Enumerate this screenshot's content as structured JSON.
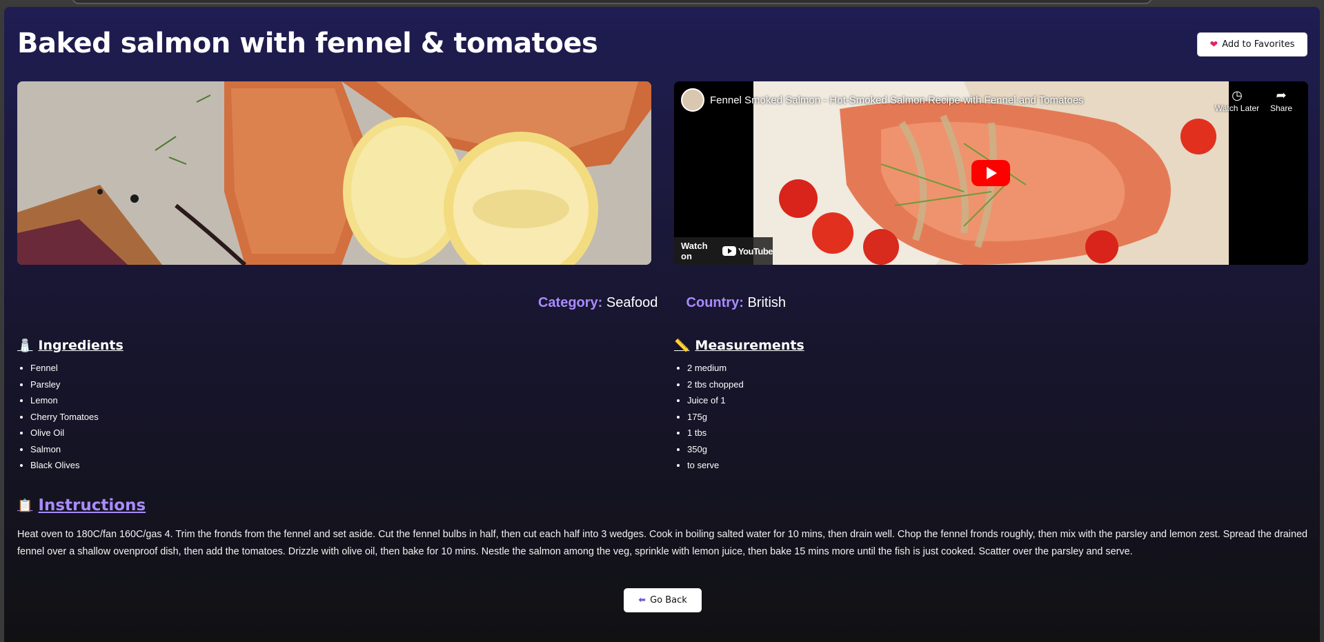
{
  "recipe": {
    "title": "Baked salmon with fennel & tomatoes",
    "favorite_label": "Add to Favorites",
    "category_label": "Category:",
    "category": "Seafood",
    "country_label": "Country:",
    "country": "British"
  },
  "video": {
    "title": "Fennel Smoked Salmon - Hot-Smoked Salmon Recipe with Fennel and Tomatoes",
    "watch_later": "Watch Later",
    "share": "Share",
    "watch_on": "Watch on",
    "youtube": "YouTube"
  },
  "ingredients": {
    "heading": "Ingredients",
    "icon": "salt-shaker-icon",
    "items": [
      "Fennel",
      "Parsley",
      "Lemon",
      "Cherry Tomatoes",
      "Olive Oil",
      "Salmon",
      "Black Olives"
    ]
  },
  "measurements": {
    "heading": "Measurements",
    "icon": "ruler-icon",
    "items": [
      "2 medium",
      "2 tbs chopped",
      "Juice of 1",
      "175g",
      "1 tbs",
      "350g",
      "to serve"
    ]
  },
  "instructions": {
    "heading": "Instructions",
    "icon": "clipboard-icon",
    "text": "Heat oven to 180C/fan 160C/gas 4. Trim the fronds from the fennel and set aside. Cut the fennel bulbs in half, then cut each half into 3 wedges. Cook in boiling salted water for 10 mins, then drain well. Chop the fennel fronds roughly, then mix with the parsley and lemon zest. Spread the drained fennel over a shallow ovenproof dish, then add the tomatoes. Drizzle with olive oil, then bake for 10 mins. Nestle the salmon among the veg, sprinkle with lemon juice, then bake 15 mins more until the fish is just cooked. Scatter over the parsley and serve."
  },
  "nav": {
    "back_label": "Go Back",
    "back_icon_text": "BACK"
  },
  "colors": {
    "accent": "#a98bff",
    "background_top": "#1f1d52",
    "background_bottom": "#111114",
    "youtube_red": "#ff0000"
  }
}
